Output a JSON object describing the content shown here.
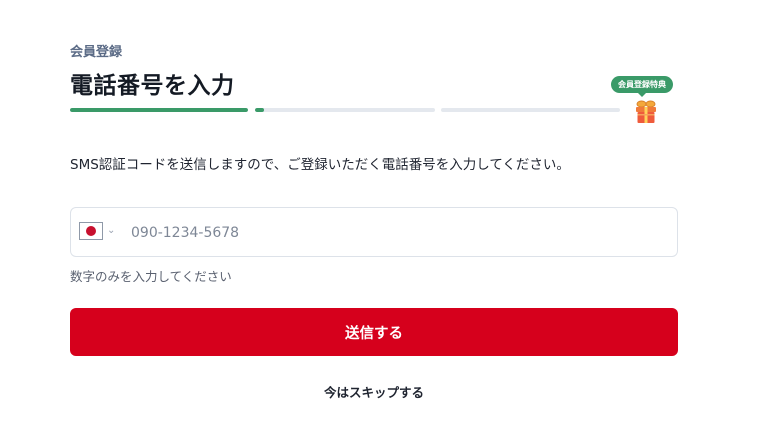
{
  "header": {
    "eyebrow": "会員登録",
    "title": "電話番号を入力"
  },
  "progress": {
    "steps": [
      {
        "fill": 1.0
      },
      {
        "fill": 0.05
      },
      {
        "fill": 0.0
      }
    ],
    "reward_badge": "会員登録特典",
    "reward_icon": "gift-icon"
  },
  "description": "SMS認証コードを送信しますので、ご登録いただく電話番号を入力してください。",
  "phone": {
    "country_icon": "japan-flag-icon",
    "placeholder": "090-1234-5678",
    "value": ""
  },
  "hint": "数字のみを入力してください",
  "actions": {
    "submit_label": "送信する",
    "skip_label": "今はスキップする"
  },
  "colors": {
    "accent_green": "#3a9a68",
    "submit_red": "#d6001c"
  }
}
